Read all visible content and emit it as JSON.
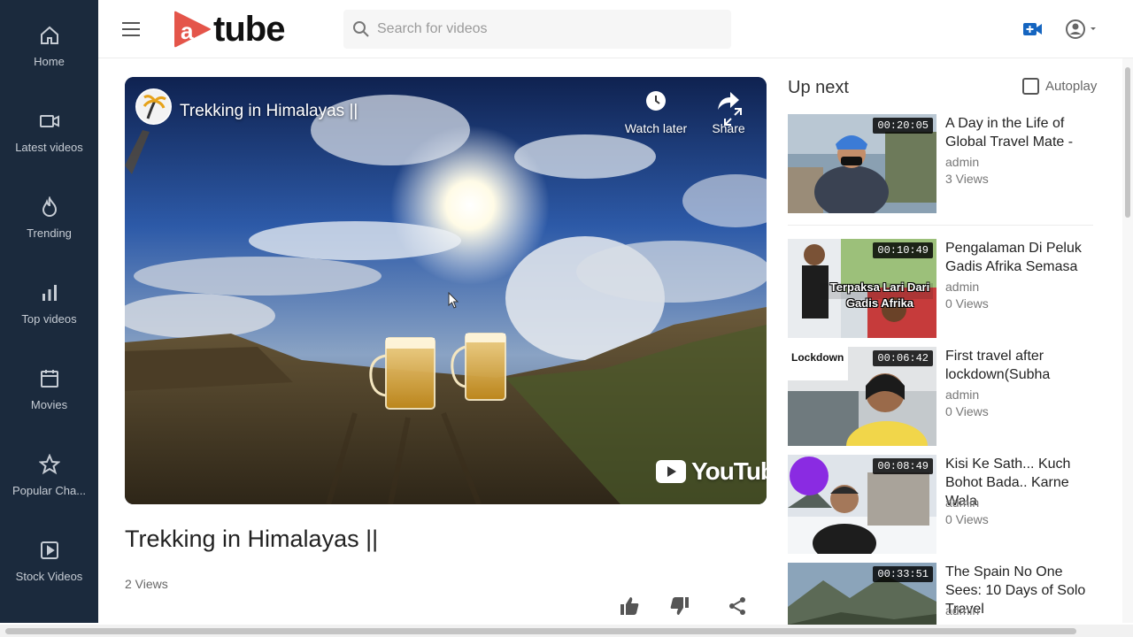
{
  "app": {
    "logo_text": "tube",
    "brand_color": "#e4554a"
  },
  "sidebar": {
    "items": [
      {
        "label": "Home",
        "icon": "home-icon"
      },
      {
        "label": "Latest videos",
        "icon": "video-camera-icon"
      },
      {
        "label": "Trending",
        "icon": "flame-icon"
      },
      {
        "label": "Top videos",
        "icon": "bar-chart-icon"
      },
      {
        "label": "Movies",
        "icon": "calendar-icon"
      },
      {
        "label": "Popular Cha...",
        "icon": "star-icon"
      },
      {
        "label": "Stock Videos",
        "icon": "play-square-icon"
      }
    ]
  },
  "header": {
    "search_placeholder": "Search for videos",
    "upload_icon": "video-upload-icon",
    "account_icon": "account-circle-icon"
  },
  "player": {
    "title": "Trekking in Himalayas ||",
    "watch_later_label": "Watch later",
    "share_label": "Share",
    "watermark_text": "YouTube"
  },
  "video": {
    "title": "Trekking in Himalayas ||",
    "views": "2 Views"
  },
  "upnext": {
    "title": "Up next",
    "autoplay_label": "Autoplay",
    "items": [
      {
        "duration": "00:20:05",
        "title": "A Day in the Life of Global Travel Mate -",
        "author": "admin",
        "views": "3 Views"
      },
      {
        "duration": "00:10:49",
        "title": "Pengalaman Di Peluk Gadis Afrika Semasa",
        "author": "admin",
        "views": "0 Views",
        "thumb_caption": "Terpaksa Lari Dari Gadis Afrika"
      },
      {
        "duration": "00:06:42",
        "title": "First travel after lockdown(Subha",
        "author": "admin",
        "views": "0 Views",
        "thumb_caption": "Lockdown"
      },
      {
        "duration": "00:08:49",
        "title": "Kisi Ke Sath... Kuch Bohot Bada.. Karne Wala",
        "author": "admin",
        "views": "0 Views"
      },
      {
        "duration": "00:33:51",
        "title": "The Spain No One Sees: 10 Days of Solo Travel",
        "author": "admin",
        "views": ""
      }
    ]
  }
}
